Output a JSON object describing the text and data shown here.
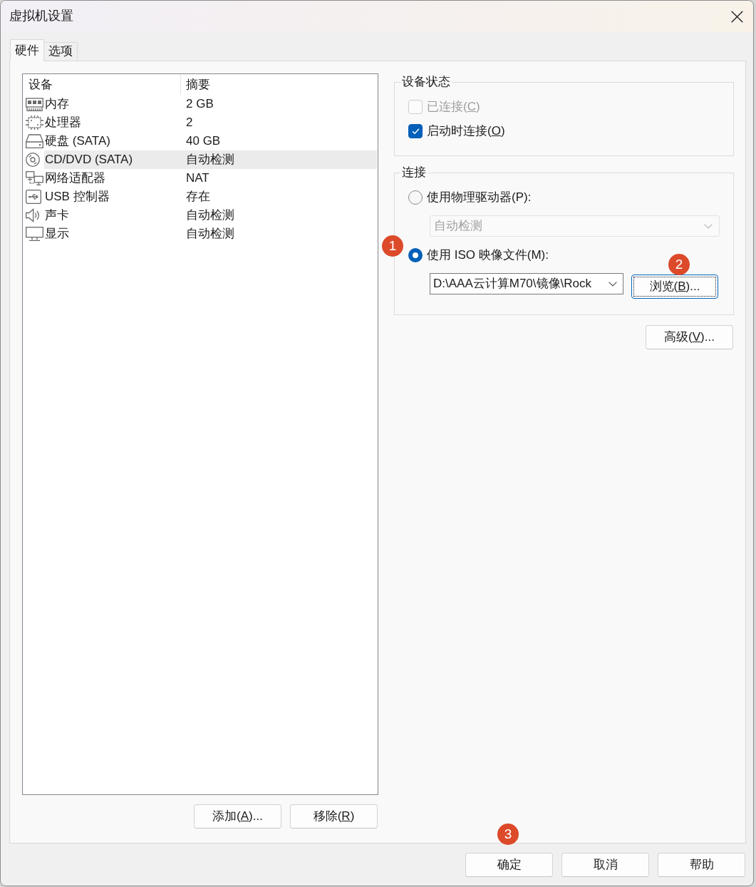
{
  "window": {
    "title": "虚拟机设置"
  },
  "tabs": [
    {
      "label": "硬件",
      "selected": true
    },
    {
      "label": "选项",
      "selected": false
    }
  ],
  "device_list": {
    "columns": [
      "设备",
      "摘要"
    ],
    "rows": [
      {
        "kind": "memory",
        "name": "内存",
        "summary": "2 GB",
        "selected": false
      },
      {
        "kind": "cpu",
        "name": "处理器",
        "summary": "2",
        "selected": false
      },
      {
        "kind": "disk",
        "name": "硬盘 (SATA)",
        "summary": "40 GB",
        "selected": false
      },
      {
        "kind": "cdrom",
        "name": "CD/DVD (SATA)",
        "summary": "自动检测",
        "selected": true
      },
      {
        "kind": "network",
        "name": "网络适配器",
        "summary": "NAT",
        "selected": false
      },
      {
        "kind": "usb",
        "name": "USB 控制器",
        "summary": "存在",
        "selected": false
      },
      {
        "kind": "sound",
        "name": "声卡",
        "summary": "自动检测",
        "selected": false
      },
      {
        "kind": "display",
        "name": "显示",
        "summary": "自动检测",
        "selected": false
      }
    ]
  },
  "list_buttons": [
    {
      "label": {
        "text": "添加(",
        "access_key": "A",
        "text_after": ")..."
      }
    },
    {
      "label": {
        "text": "移除(",
        "access_key": "R",
        "text_after": ")"
      }
    }
  ],
  "device_status": {
    "title": "设备状态",
    "checkboxes": [
      {
        "label": {
          "text": "已连接(",
          "access_key": "C",
          "text_after": ")"
        },
        "checked": false,
        "disabled": true
      },
      {
        "label": {
          "text": "启动时连接(",
          "access_key": "O",
          "text_after": ")"
        },
        "checked": true,
        "disabled": false
      }
    ]
  },
  "connection": {
    "title": "连接",
    "options": [
      {
        "kind": "physical",
        "label": "使用物理驱动器(P):",
        "selected": false,
        "drive": {
          "value": "自动检测",
          "disabled": true
        }
      },
      {
        "kind": "iso",
        "label": "使用 ISO 映像文件(M):",
        "selected": true,
        "marker": "1",
        "path": {
          "value": "D:\\AAA云计算M70\\镜像\\Rock"
        },
        "browse_button": {
          "label": {
            "text": "浏览(",
            "access_key": "B",
            "text_after": ")..."
          },
          "focused": true,
          "marker": "2"
        }
      }
    ]
  },
  "advanced_button": {
    "label": {
      "text": "高级(",
      "access_key": "V",
      "text_after": ")..."
    }
  },
  "dialog_buttons": [
    {
      "label": "确定",
      "marker": "3"
    },
    {
      "label": "取消"
    },
    {
      "label": "帮助"
    }
  ]
}
